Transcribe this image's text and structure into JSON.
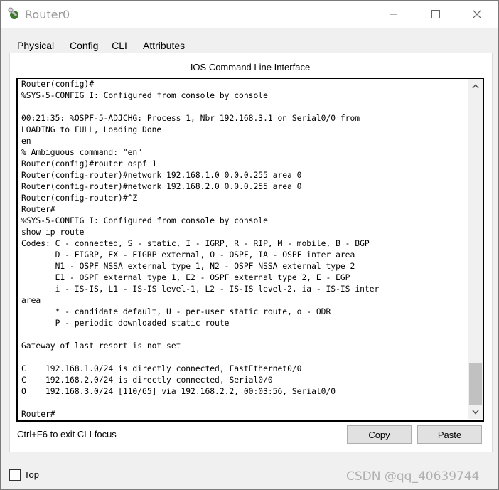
{
  "window": {
    "title": "Router0",
    "minimize_icon": "minimize-icon",
    "maximize_icon": "maximize-icon",
    "close_icon": "close-icon"
  },
  "tabs": [
    {
      "label": "Physical"
    },
    {
      "label": "Config"
    },
    {
      "label": "CLI",
      "active": true
    },
    {
      "label": "Attributes"
    }
  ],
  "cli": {
    "heading": "IOS Command Line Interface",
    "lines": [
      "Router(config)#",
      "%SYS-5-CONFIG_I: Configured from console by console",
      "",
      "00:21:35: %OSPF-5-ADJCHG: Process 1, Nbr 192.168.3.1 on Serial0/0 from",
      "LOADING to FULL, Loading Done",
      "en",
      "% Ambiguous command: \"en\"",
      "Router(config)#router ospf 1",
      "Router(config-router)#network 192.168.1.0 0.0.0.255 area 0",
      "Router(config-router)#network 192.168.2.0 0.0.0.255 area 0",
      "Router(config-router)#^Z",
      "Router#",
      "%SYS-5-CONFIG_I: Configured from console by console",
      "show ip route",
      "Codes: C - connected, S - static, I - IGRP, R - RIP, M - mobile, B - BGP",
      "       D - EIGRP, EX - EIGRP external, O - OSPF, IA - OSPF inter area",
      "       N1 - OSPF NSSA external type 1, N2 - OSPF NSSA external type 2",
      "       E1 - OSPF external type 1, E2 - OSPF external type 2, E - EGP",
      "       i - IS-IS, L1 - IS-IS level-1, L2 - IS-IS level-2, ia - IS-IS inter",
      "area",
      "       * - candidate default, U - per-user static route, o - ODR",
      "       P - periodic downloaded static route",
      "",
      "Gateway of last resort is not set",
      "",
      "C    192.168.1.0/24 is directly connected, FastEthernet0/0",
      "C    192.168.2.0/24 is directly connected, Serial0/0",
      "O    192.168.3.0/24 [110/65] via 192.168.2.2, 00:03:56, Serial0/0",
      "",
      "Router#"
    ]
  },
  "footer": {
    "focus_hint": "Ctrl+F6 to exit CLI focus",
    "copy_label": "Copy",
    "paste_label": "Paste",
    "top_label": "Top",
    "top_checked": false
  },
  "watermark": "CSDN @qq_40639744"
}
